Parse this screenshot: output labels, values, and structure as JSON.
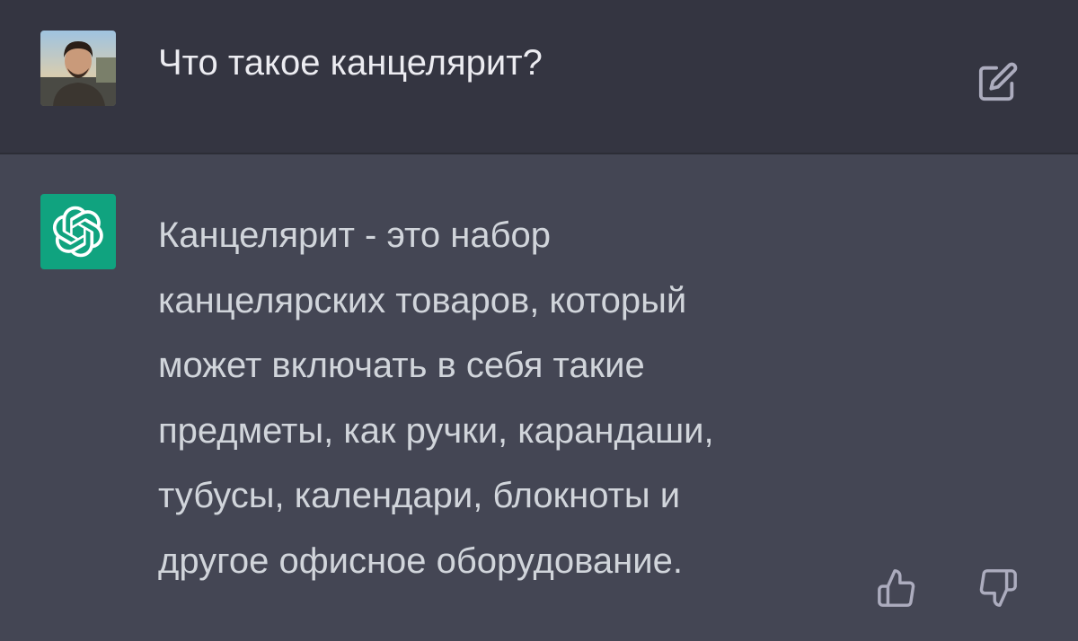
{
  "user_message": {
    "text": "Что такое канцелярит?",
    "avatar_icon": "user-photo-avatar",
    "edit_icon": "edit-icon"
  },
  "assistant_message": {
    "avatar_icon": "openai-logo-icon",
    "lines": [
      "Канцелярит - это набор",
      "канцелярских товаров, который",
      "может включать в себя такие",
      "предметы, как ручки, карандаши,",
      "тубусы, календари, блокноты и",
      "другое офисное оборудование."
    ],
    "feedback_icons": [
      "thumbs-up-icon",
      "thumbs-down-icon"
    ]
  },
  "colors": {
    "user_bg": "#343541",
    "assistant_bg": "#444654",
    "bot_avatar": "#10a37f",
    "text": "#d1d5db"
  }
}
